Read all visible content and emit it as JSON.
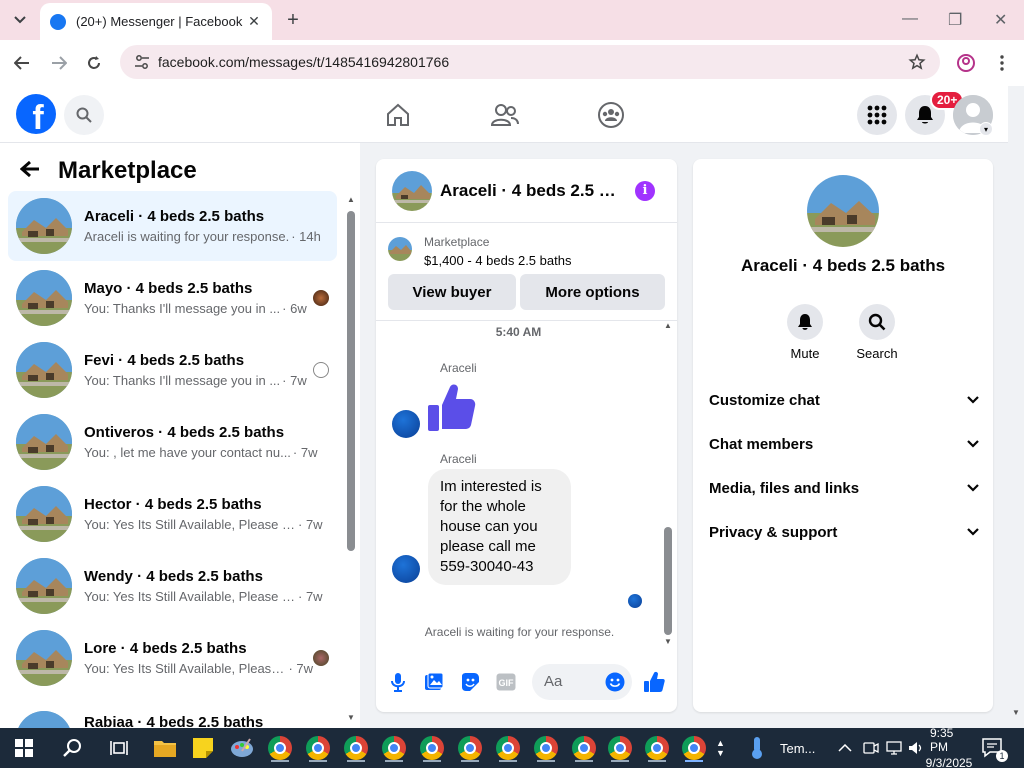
{
  "browser": {
    "tab_title": "(20+) Messenger | Facebook",
    "url": "facebook.com/messages/t/1485416942801766"
  },
  "fb_header": {
    "notification_badge": "20+"
  },
  "left_panel": {
    "title": "Marketplace",
    "conversations": [
      {
        "name": "Araceli · 4 beds 2.5 baths",
        "message": "Araceli is waiting for your response.",
        "time": "· 14h",
        "active": true
      },
      {
        "name": "Mayo · 4 beds 2.5 baths",
        "message": "You: Thanks I'll message you in ...",
        "time": "· 6w"
      },
      {
        "name": "Fevi · 4 beds 2.5 baths",
        "message": "You: Thanks I'll message you in ...",
        "time": "· 7w"
      },
      {
        "name": "Ontiveros · 4 beds 2.5 baths",
        "message": "You: , let me have your contact nu...",
        "time": "· 7w"
      },
      {
        "name": "Hector · 4 beds 2.5 baths",
        "message": "You: Yes Its Still Available, Please Se...",
        "time": "· 7w"
      },
      {
        "name": "Wendy · 4 beds 2.5 baths",
        "message": "You: Yes Its Still Available, Please Se...",
        "time": "· 7w"
      },
      {
        "name": "Lore · 4 beds 2.5 baths",
        "message": "You: Yes Its Still Available, Please...",
        "time": "· 7w"
      },
      {
        "name": "Rabiaa · 4 beds 2.5 baths",
        "message": "",
        "time": ""
      }
    ]
  },
  "chat": {
    "header_name": "Araceli · 4 beds 2.5 b...",
    "listing_source": "Marketplace",
    "listing_detail": "$1,400 - 4 beds 2.5 baths",
    "view_buyer": "View buyer",
    "more_options": "More options",
    "timestamp": "5:40 AM",
    "sender1": "Araceli",
    "sender2": "Araceli",
    "message_lines": [
      "Im interested is",
      "for the whole",
      "house can you",
      "please call me",
      "559-30040-43"
    ],
    "waiting": "Araceli is waiting for your response.",
    "composer_placeholder": "Aa"
  },
  "info": {
    "name": "Araceli · 4 beds 2.5 baths",
    "mute": "Mute",
    "search": "Search",
    "rows": [
      "Customize chat",
      "Chat members",
      "Media, files and links",
      "Privacy & support"
    ]
  },
  "taskbar": {
    "weather": "Tem...",
    "time": "9:35 PM",
    "date": "9/3/2025",
    "notif_count": "1"
  },
  "colors": {
    "fb_blue": "#0866ff",
    "active_row": "#ebf5ff",
    "info_purple": "#a033ff",
    "badge_red": "#e41e3f"
  }
}
